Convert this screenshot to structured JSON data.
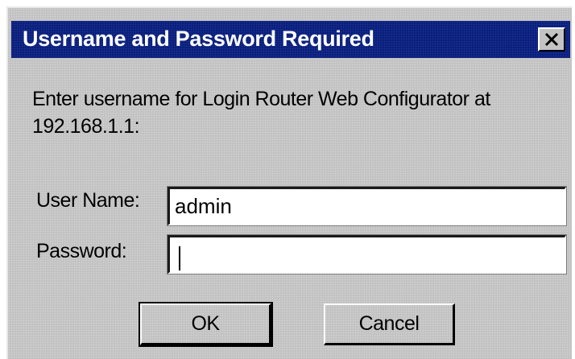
{
  "dialog": {
    "title": "Username and Password Required",
    "close_label": "✕",
    "prompt_line1": "Enter username for Login Router Web Configurator at",
    "prompt_line2": "192.168.1.1:"
  },
  "form": {
    "username_label": "User Name:",
    "username_value": "admin",
    "password_label": "Password:",
    "password_value": ""
  },
  "buttons": {
    "ok_label": "OK",
    "cancel_label": "Cancel"
  },
  "colors": {
    "titlebar": "#0a1f7c",
    "dialog_face": "#c3c3c3",
    "title_text": "#ffffff"
  },
  "icons": {
    "close": "close-icon"
  }
}
